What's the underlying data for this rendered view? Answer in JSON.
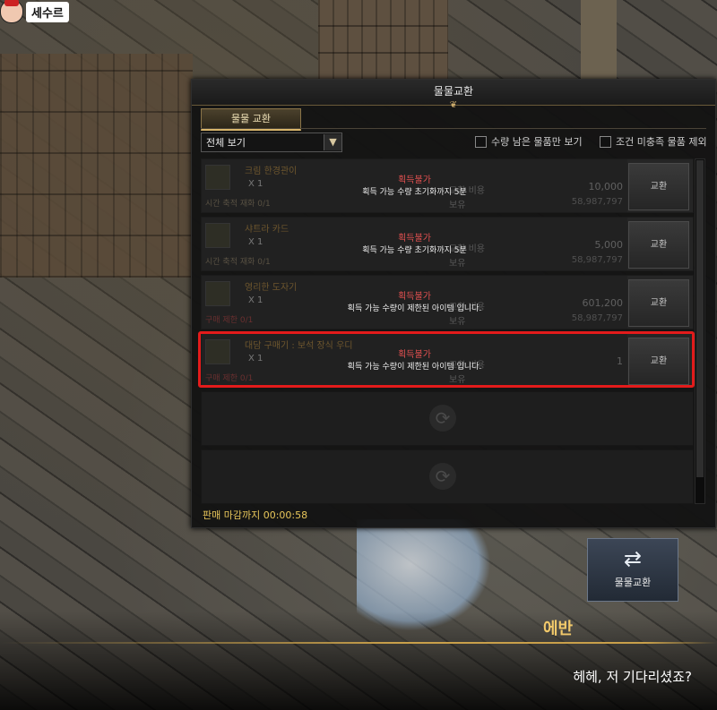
{
  "player": {
    "name": "세수르",
    "icon": "player-avatar-icon"
  },
  "dialog": {
    "title": "물물교환",
    "tab": "물물 교환",
    "filter": {
      "value": "전체 보기",
      "arrow": "chevron-down-icon"
    },
    "options": [
      {
        "label": "수량 남은 물품만 보기",
        "checked": false
      },
      {
        "label": "조건 미충족 물품 제외",
        "checked": false
      }
    ],
    "items": [
      {
        "name": "크림 한경관이",
        "qty": "X 1",
        "sub": "시간 축적 재화 0/1",
        "sub_red": false,
        "cost_label": "교환 비용",
        "stock_label": "보유",
        "cost": "10,000",
        "stock": "58,987,797",
        "status": "획득불가",
        "message": "획득 가능 수량 초기화까지 5분",
        "button": "교환"
      },
      {
        "name": "샤트라 카드",
        "qty": "X 1",
        "sub": "시간 축적 재화 0/1",
        "sub_red": false,
        "cost_label": "교환 비용",
        "stock_label": "보유",
        "cost": "5,000",
        "stock": "58,987,797",
        "status": "획득불가",
        "message": "획득 가능 수량 초기화까지 5분",
        "button": "교환"
      },
      {
        "name": "영리한 도자기",
        "qty": "X 1",
        "sub": "구매 제한 0/1",
        "sub_red": true,
        "cost_label": "교환 비용",
        "stock_label": "보유",
        "cost": "601,200",
        "stock": "58,987,797",
        "status": "획득불가",
        "message": "획득 가능 수량이 제한된 아이템 입니다.",
        "button": "교환"
      },
      {
        "name": "대담 구매기 : 보석 장식 우디",
        "qty": "X 1",
        "sub": "구매 제한 0/1",
        "sub_red": true,
        "cost_label": "교환 비용",
        "stock_label": "보유",
        "cost": "1",
        "stock": "",
        "status": "획득불가",
        "message": "획득 가능 수량이 제한된 아이템 입니다.",
        "button": "교환"
      }
    ],
    "timer": "판매 마감까지 00:00:58"
  },
  "barter_button": {
    "label": "물물교환",
    "icon": "exchange-arrows-icon"
  },
  "npc": {
    "name": "에반",
    "speech": "헤헤, 저 기다리셨죠?"
  },
  "colors": {
    "highlight": "#e31b1b",
    "status": "#e05050",
    "accent": "#e8c65a"
  }
}
